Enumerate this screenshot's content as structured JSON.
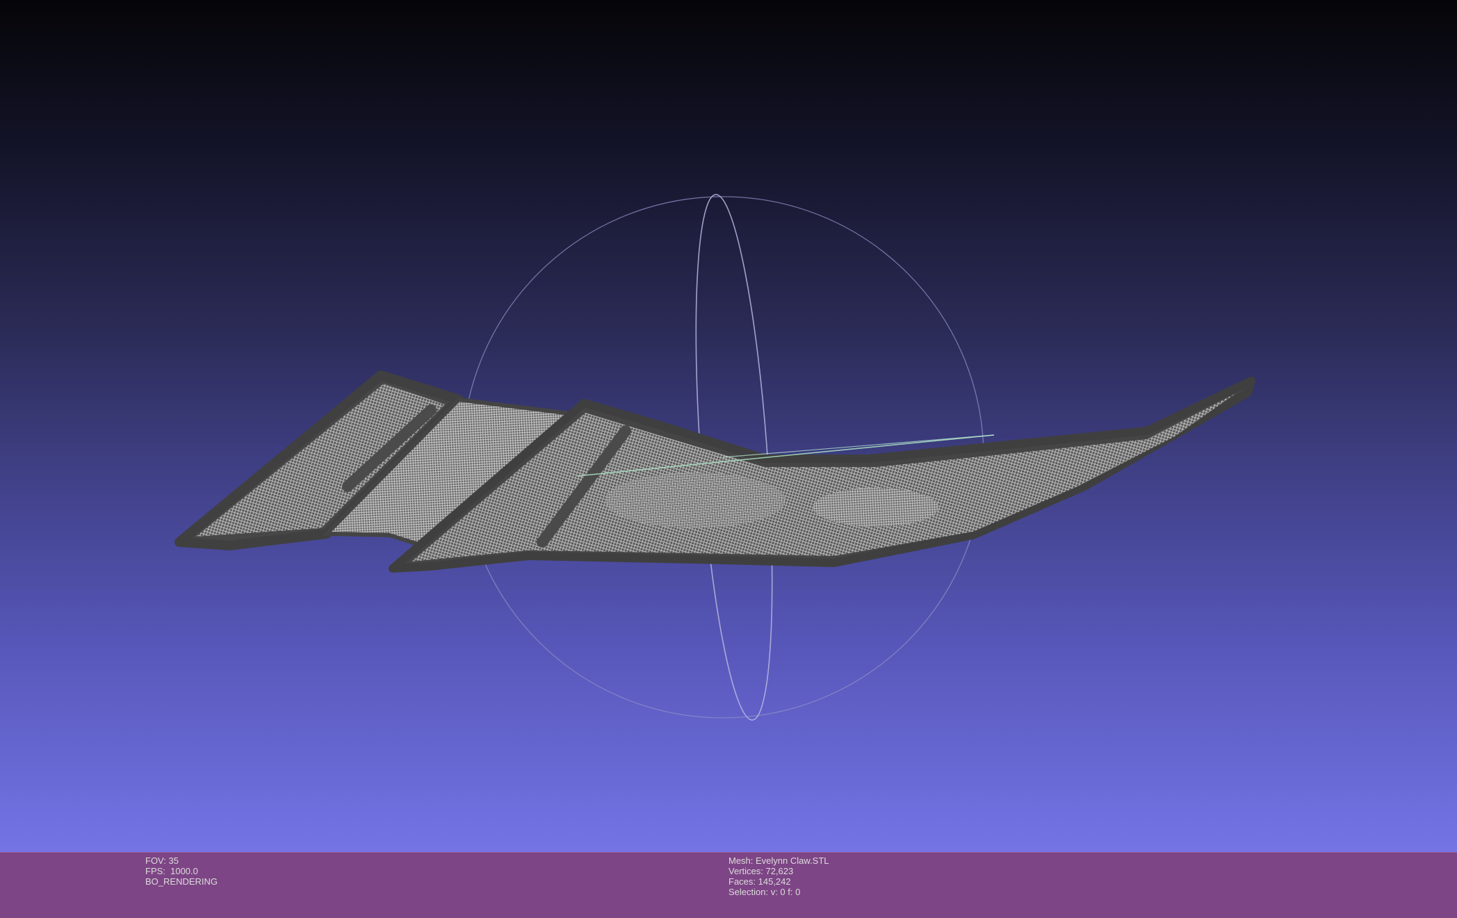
{
  "viewer": {
    "background_top": "#050508",
    "background_bottom": "#7474e6",
    "mesh_color": "#4a4a4a",
    "wire_color": "#c8c8c8",
    "trackball_color": "#9a9ac8",
    "axis_color": "#9ad0b0"
  },
  "status": {
    "fov": "FOV: 35",
    "fps": "FPS:  1000.0",
    "render_mode": "BO_RENDERING",
    "mesh": "Mesh: Evelynn Claw.STL",
    "vertices": "Vertices: 72,623",
    "faces": "Faces: 145,242",
    "selection": "Selection: v: 0 f: 0"
  },
  "colors": {
    "statusbar_bg": "#7d4585",
    "statusbar_text": "#dcdcdc"
  }
}
